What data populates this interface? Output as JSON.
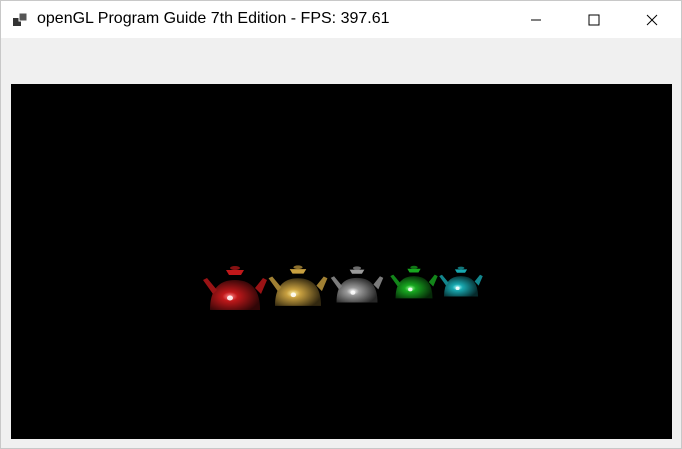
{
  "window": {
    "title": "openGL Program Guide 7th Edition - FPS: 397.61",
    "app_icon": "windows-console-icon",
    "controls": {
      "minimize_icon": "minimize-icon",
      "maximize_icon": "maximize-icon",
      "close_icon": "close-icon"
    }
  },
  "scene": {
    "background": "#000000",
    "teapots": [
      {
        "name": "red",
        "color": "#c0181a",
        "highlight": "#ff8a8a"
      },
      {
        "name": "gold",
        "color": "#c8a040",
        "highlight": "#fff0a0"
      },
      {
        "name": "silver",
        "color": "#9a9a9a",
        "highlight": "#ffffff"
      },
      {
        "name": "green",
        "color": "#18a820",
        "highlight": "#a0ffa0"
      },
      {
        "name": "cyan",
        "color": "#18a8b0",
        "highlight": "#b0ffff"
      }
    ]
  }
}
